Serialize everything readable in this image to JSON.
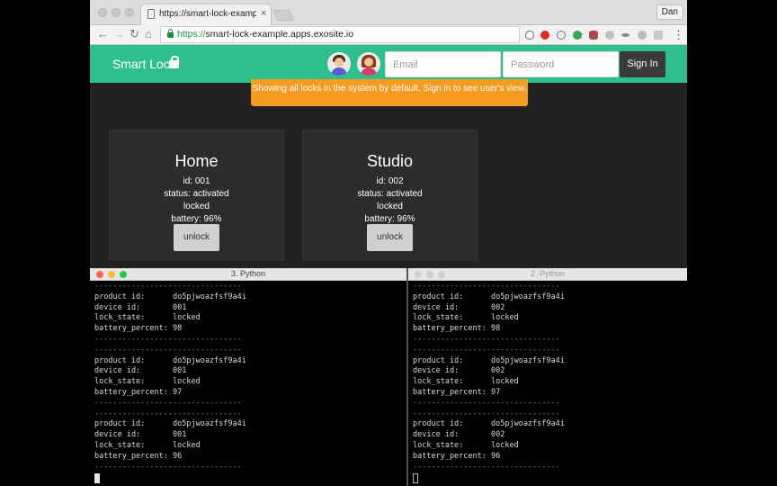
{
  "browser": {
    "tab_title": "https://smart-lock-example.ap",
    "tab_close": "×",
    "user_badge": "Dan",
    "nav_back": "←",
    "nav_forward": "→",
    "nav_reload": "↻",
    "nav_home": "⌂",
    "url_protocol": "https://",
    "url_host": "smart-lock-example.apps.exosite.io",
    "bookmark": "☆",
    "menu": "⋮"
  },
  "page": {
    "brand": "Smart Lock",
    "email_placeholder": "Email",
    "password_placeholder": "Password",
    "signin_label": "Sign In",
    "banner": "Showing all locks in the system by default. Sign in to see user's view.",
    "locks": [
      {
        "name": "Home",
        "id": "id: 001",
        "status": "status: activated",
        "state": "locked",
        "battery": "battery: 96%",
        "button": "unlock"
      },
      {
        "name": "Studio",
        "id": "id: 002",
        "status": "status: activated",
        "state": "locked",
        "battery": "battery: 96%",
        "button": "unlock"
      }
    ]
  },
  "terminals": [
    {
      "title": "3. Python",
      "lines": [
        "--------------------------------",
        "product id:      do5pjwoazfsf9a4i",
        "device id:       001",
        "lock_state:      locked",
        "battery_percent: 98",
        "--------------------------------",
        "--------------------------------",
        "product id:      do5pjwoazfsf9a4i",
        "device id:       001",
        "lock_state:      locked",
        "battery_percent: 97",
        "--------------------------------",
        "--------------------------------",
        "product id:      do5pjwoazfsf9a4i",
        "device id:       001",
        "lock_state:      locked",
        "battery_percent: 96",
        "--------------------------------"
      ]
    },
    {
      "title": "2. Python",
      "lines": [
        "--------------------------------",
        "product id:      do5pjwoazfsf9a4i",
        "device id:       002",
        "lock_state:      locked",
        "battery_percent: 98",
        "--------------------------------",
        "--------------------------------",
        "product id:      do5pjwoazfsf9a4i",
        "device id:       002",
        "lock_state:      locked",
        "battery_percent: 97",
        "--------------------------------",
        "--------------------------------",
        "product id:      do5pjwoazfsf9a4i",
        "device id:       002",
        "lock_state:      locked",
        "battery_percent: 96",
        "--------------------------------"
      ]
    }
  ],
  "colors": {
    "navbar": "#2fbf8f",
    "banner": "#f59b1f",
    "page_bg": "#222222",
    "card_bg": "#2c2c2c",
    "signin_bg": "#3a3a3a",
    "url_secure": "#1e8e3e"
  },
  "icons": {
    "brand": "lock-icon",
    "url": "secure-lock-icon",
    "avatars": [
      "male-avatar-icon",
      "female-avatar-icon"
    ]
  }
}
